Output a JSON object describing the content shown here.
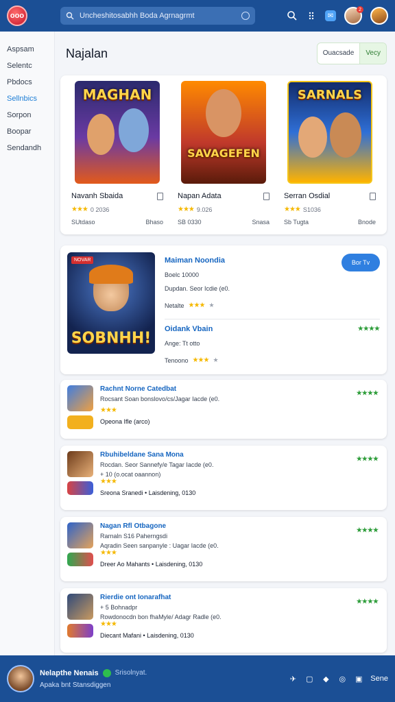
{
  "topbar": {
    "logo": "ooo",
    "search_placeholder": "Uncheshitosabhh Boda Agrnagrmt",
    "notification_count": "2",
    "icons": [
      "search-icon",
      "grid-icon",
      "message-icon"
    ]
  },
  "sidebar": {
    "items": [
      {
        "label": "Aspsam",
        "active": false
      },
      {
        "label": "Selentc",
        "active": false
      },
      {
        "label": "Pbdocs",
        "active": false
      },
      {
        "label": "Sellnbics",
        "active": true
      },
      {
        "label": "Sorpon",
        "active": false
      },
      {
        "label": "Boopar",
        "active": false
      },
      {
        "label": "Sendandh",
        "active": false
      }
    ]
  },
  "page": {
    "title": "Najalan",
    "segment": [
      "Ouacsade",
      "Vecy"
    ]
  },
  "featured": [
    {
      "cover": "MAGHAN",
      "name": "Navanh Sbaida",
      "rating": "3.0",
      "meta": "0 2036",
      "foot_left": "SUtdaso",
      "foot_right": "Bhaso"
    },
    {
      "cover": "SAVAGEFEN",
      "name": "Napan Adata",
      "rating": "3.0",
      "meta": "9.026",
      "foot_left": "SB 0330",
      "foot_right": "Snasa"
    },
    {
      "cover": "SARNALS",
      "name": "Serran Osdial",
      "rating": "3.0",
      "meta": "S1036",
      "foot_left": "Sb Tugta",
      "foot_right": "Bnode"
    }
  ],
  "detail": {
    "cover_tag": "NOVAR",
    "cover_word": "SOBNHH!",
    "title": "Maiman Noondia",
    "line1": "Boelc 10000",
    "line2": "Dupdan. Seor Icdie (e0.",
    "rate_label": "Netalte",
    "rating": "3.0",
    "second_title": "Oidank Vbain",
    "second_line": "Ange: Tt otto",
    "second_rate_label": "Tenoono",
    "second_rating": "3.0",
    "green_rating": "4.5",
    "play_label": "Bor Tv"
  },
  "list": [
    {
      "title": "Rachnt Norne Catedbat",
      "line1": "Rocsant Soan bonslovo/cs/Jagar Iacde (e0.",
      "line2": "",
      "rating": "3.0",
      "foot": "Opeona Ifle (arco)",
      "green": "4.5"
    },
    {
      "title": "Rbuhibeldane Sana Mona",
      "line1": "Rocdan. Seor Sannefy/e Tagar Iacde (e0.",
      "line2": "+ 10 (o.ocat oaannon)",
      "rating": "3.0",
      "foot": "Sreona Sranedi • Laisdening, 0130",
      "green": "4.5"
    },
    {
      "title": "Nagan Rfl Otbagone",
      "line1": "Rarnaln S16 Paherngsdi",
      "line2": "Aqradin Seen sanpanyle : Uagar Iacde (e0.",
      "rating": "3.0",
      "foot": "Dreer Ao Mahants • Laisdening, 0130",
      "green": "4.5"
    },
    {
      "title": "Rierdie ont Ionarafhat",
      "line1": "+ 5 Bohnadpr",
      "line2": "Rowdonocdn bon fhaMyle/ Adagr Radle (e0.",
      "rating": "3.0",
      "foot": "Diecant Mafani • Laisdening, 0130",
      "green": "4.5"
    }
  ],
  "bottombar": {
    "name": "Nelapthe Nenais",
    "status": "Srisolnyat.",
    "subtitle": "Apaka bnt Stansdiggen",
    "label": "Sene"
  },
  "colors": {
    "primary": "#1b4f95",
    "accent": "#2f7fe0",
    "star": "#f5b800",
    "green": "#2e9d3a"
  }
}
